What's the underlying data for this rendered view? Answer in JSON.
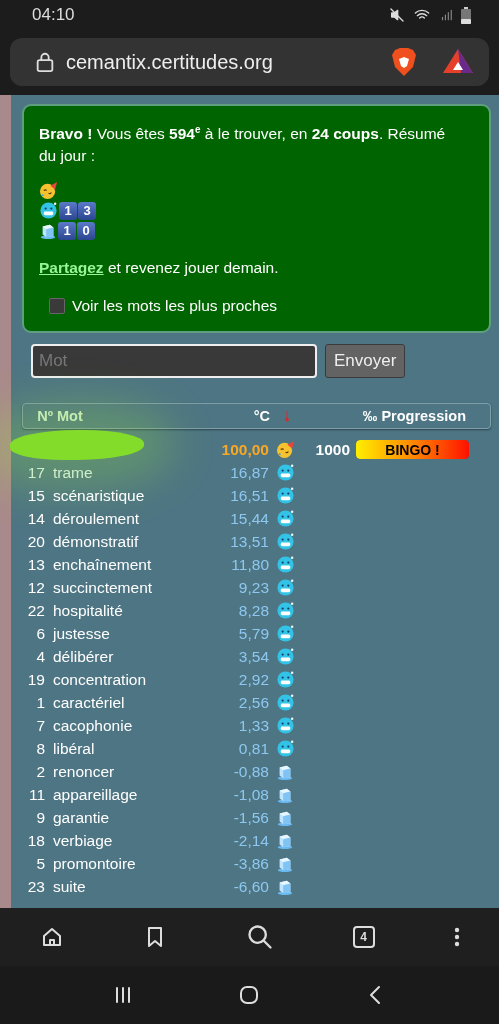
{
  "status_bar": {
    "time": "04:10"
  },
  "browser": {
    "url": "cemantix.certitudes.org",
    "tab_count": "4"
  },
  "result": {
    "message": "**Bravo !** Vous êtes **594$^{e}$** à le trouver, en **24 coups**. Résumé du jour :",
    "summary": [
      {
        "kind": "party"
      },
      {
        "kind": "cold",
        "digits": [
          "1",
          "3"
        ]
      },
      {
        "kind": "ice",
        "digits": [
          "1",
          "0"
        ]
      }
    ],
    "share_link": "Partagez",
    "share_text": " et revenez jouer demain.",
    "closest_checkbox": {
      "label": "Voir les mots les plus proches",
      "checked": false
    }
  },
  "guess": {
    "placeholder": "Mot",
    "button": "Envoyer"
  },
  "table": {
    "columns": [
      "Nº",
      "Mot",
      "°C",
      "‰ Progression"
    ],
    "rows": [
      {
        "kind": "party",
        "number": "",
        "word": "",
        "temp": "100,00",
        "progress": "1000",
        "bar_label": "BINGO !",
        "level": 1,
        "redacted": true
      },
      {
        "kind": "cold",
        "number": "17",
        "word": "trame",
        "temp": "16,87",
        "latest": true
      },
      {
        "kind": "cold",
        "number": "15",
        "word": "scénaristique",
        "temp": "16,51"
      },
      {
        "kind": "cold",
        "number": "14",
        "word": "déroulement",
        "temp": "15,44"
      },
      {
        "kind": "cold",
        "number": "20",
        "word": "démonstratif",
        "temp": "13,51"
      },
      {
        "kind": "cold",
        "number": "13",
        "word": "enchaînement",
        "temp": "11,80"
      },
      {
        "kind": "cold",
        "number": "12",
        "word": "succinctement",
        "temp": "9,23"
      },
      {
        "kind": "cold",
        "number": "22",
        "word": "hospitalité",
        "temp": "8,28"
      },
      {
        "kind": "cold",
        "number": "6",
        "word": "justesse",
        "temp": "5,79"
      },
      {
        "kind": "cold",
        "number": "4",
        "word": "délibérer",
        "temp": "3,54"
      },
      {
        "kind": "cold",
        "number": "19",
        "word": "concentration",
        "temp": "2,92"
      },
      {
        "kind": "cold",
        "number": "1",
        "word": "caractériel",
        "temp": "2,56"
      },
      {
        "kind": "cold",
        "number": "7",
        "word": "cacophonie",
        "temp": "1,33"
      },
      {
        "kind": "cold",
        "number": "8",
        "word": "libéral",
        "temp": "0,81"
      },
      {
        "kind": "ice",
        "number": "2",
        "word": "renoncer",
        "temp": "-0,88"
      },
      {
        "kind": "ice",
        "number": "11",
        "word": "appareillage",
        "temp": "-1,08"
      },
      {
        "kind": "ice",
        "number": "9",
        "word": "garantie",
        "temp": "-1,56"
      },
      {
        "kind": "ice",
        "number": "18",
        "word": "verbiage",
        "temp": "-2,14"
      },
      {
        "kind": "ice",
        "number": "5",
        "word": "promontoire",
        "temp": "-3,86"
      },
      {
        "kind": "ice",
        "number": "23",
        "word": "suite",
        "temp": "-6,60"
      }
    ]
  }
}
